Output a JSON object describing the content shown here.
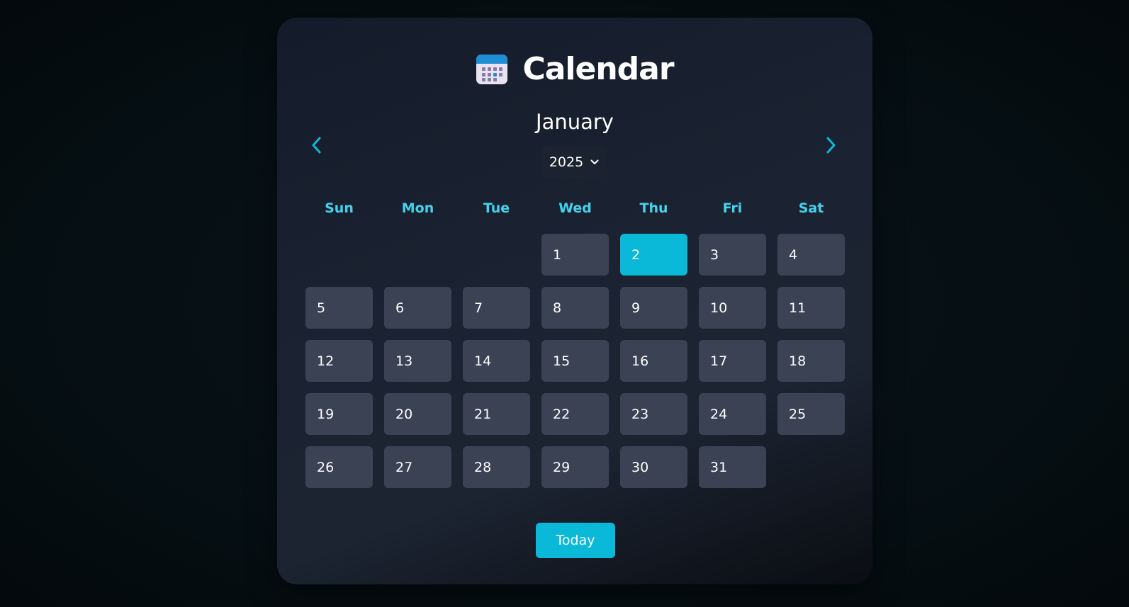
{
  "header": {
    "title": "Calendar",
    "icon": "calendar-icon"
  },
  "nav": {
    "prev_icon": "chevron-left-icon",
    "next_icon": "chevron-right-icon"
  },
  "month": "January",
  "year_select": {
    "value": "2025",
    "icon": "chevron-down-icon"
  },
  "weekdays": [
    "Sun",
    "Mon",
    "Tue",
    "Wed",
    "Thu",
    "Fri",
    "Sat"
  ],
  "days": {
    "leading_blanks": 3,
    "labels": [
      "1",
      "2",
      "3",
      "4",
      "5",
      "6",
      "7",
      "8",
      "9",
      "10",
      "11",
      "12",
      "13",
      "14",
      "15",
      "16",
      "17",
      "18",
      "19",
      "20",
      "21",
      "22",
      "23",
      "24",
      "25",
      "26",
      "27",
      "28",
      "29",
      "30",
      "31"
    ],
    "selected": "2"
  },
  "today_button": "Today",
  "colors": {
    "accent": "#0ab8d8",
    "weekday": "#46d2ec",
    "day_tile": "#3b4254",
    "card": "#1b2332"
  }
}
